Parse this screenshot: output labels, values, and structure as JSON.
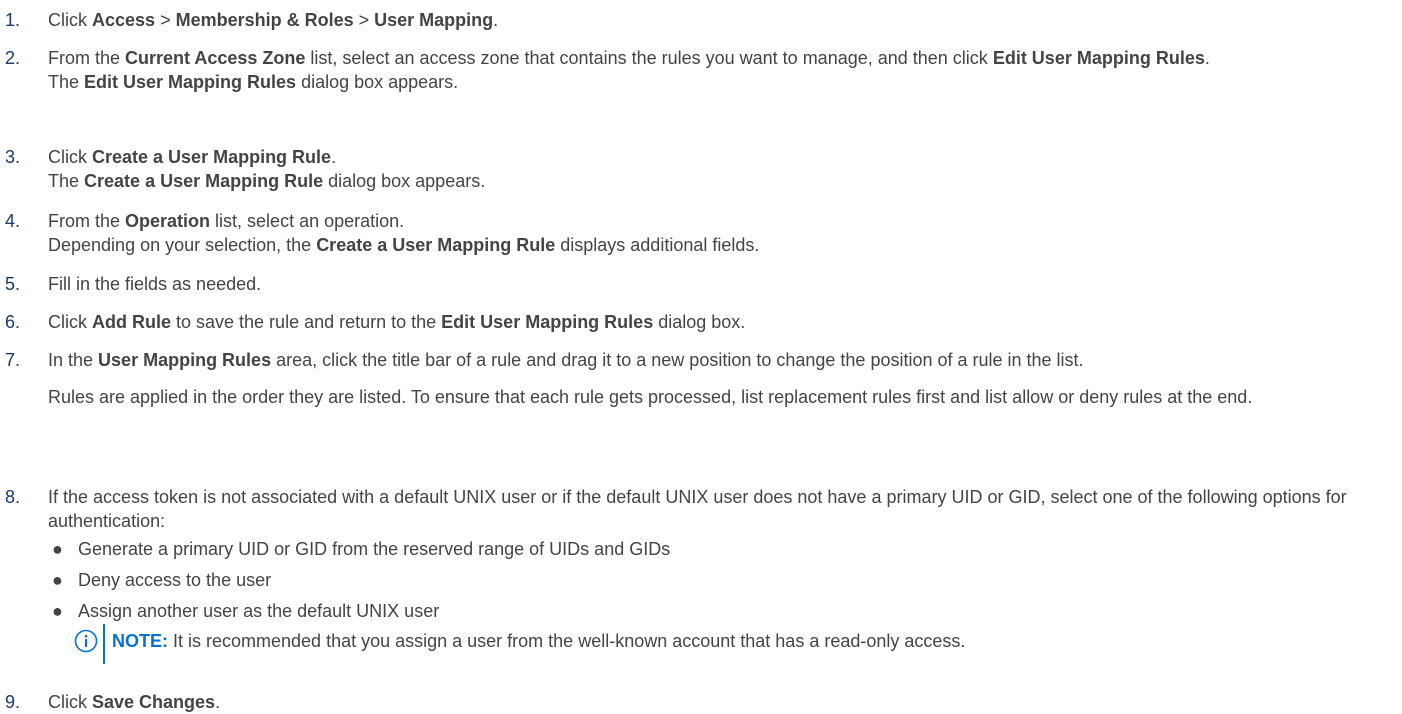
{
  "steps": [
    {
      "num": "1.",
      "parts": [
        "Click ",
        "Access",
        " > ",
        "Membership & Roles",
        " > ",
        "User Mapping",
        "."
      ]
    },
    {
      "num": "2.",
      "parts": [
        "From the ",
        "Current Access Zone",
        " list, select an access zone that contains the rules you want to manage, and then click ",
        "Edit User Mapping Rules",
        "."
      ],
      "sub": [
        "The ",
        "Edit User Mapping Rules",
        " dialog box appears."
      ]
    },
    {
      "num": "3.",
      "parts": [
        "Click ",
        "Create a User Mapping Rule",
        "."
      ],
      "sub": [
        "The ",
        "Create a User Mapping Rule",
        " dialog box appears."
      ]
    },
    {
      "num": "4.",
      "parts": [
        "From the ",
        "Operation",
        " list, select an operation."
      ],
      "sub": [
        "Depending on your selection, the ",
        "Create a User Mapping Rule",
        " displays additional fields."
      ]
    },
    {
      "num": "5.",
      "parts": [
        "Fill in the fields as needed."
      ]
    },
    {
      "num": "6.",
      "parts": [
        "Click ",
        "Add Rule",
        " to save the rule and return to the ",
        "Edit User Mapping Rules",
        " dialog box."
      ]
    },
    {
      "num": "7.",
      "parts": [
        "In the ",
        "User Mapping Rules",
        " area, click the title bar of a rule and drag it to a new position to change the position of a rule in the list."
      ],
      "para": "Rules are applied in the order they are listed. To ensure that each rule gets processed, list replacement rules first and list allow or deny rules at the end."
    },
    {
      "num": "8.",
      "parts": [
        "If the access token is not associated with a default UNIX user or if the default UNIX user does not have a primary UID or GID, select one of the following options for authentication:"
      ],
      "bullets": [
        "Generate a primary UID or GID from the reserved range of UIDs and GIDs",
        "Deny access to the user",
        "Assign another user as the default UNIX user"
      ],
      "note": {
        "label": "NOTE:",
        "text": " It is recommended that you assign a user from the well-known account that has a read-only access."
      }
    },
    {
      "num": "9.",
      "parts": [
        "Click ",
        "Save Changes",
        "."
      ]
    }
  ],
  "bullet_glyph": "●",
  "icons": {
    "note": "info-circle-icon"
  },
  "colors": {
    "text": "#444444",
    "number": "#1a3a6b",
    "note_accent": "#0672cb"
  }
}
